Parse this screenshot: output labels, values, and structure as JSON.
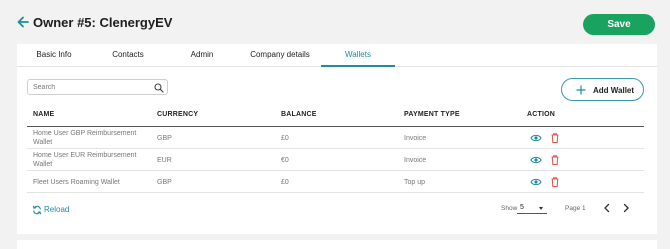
{
  "header": {
    "title": "Owner #5: ClenergyEV",
    "save_label": "Save"
  },
  "tabs": [
    {
      "label": "Basic Info",
      "active": false
    },
    {
      "label": "Contacts",
      "active": false
    },
    {
      "label": "Admin",
      "active": false
    },
    {
      "label": "Company details",
      "active": false
    },
    {
      "label": "Wallets",
      "active": true
    }
  ],
  "search": {
    "placeholder": "Search",
    "value": ""
  },
  "add_wallet_label": "Add Wallet",
  "table": {
    "columns": [
      "NAME",
      "CURRENCY",
      "BALANCE",
      "PAYMENT TYPE",
      "ACTION"
    ],
    "rows": [
      {
        "name": "Home User GBP Reimbursement Wallet",
        "currency": "GBP",
        "balance": "£0",
        "payment_type": "Invoice"
      },
      {
        "name": "Home User EUR Reimbursement Wallet",
        "currency": "EUR",
        "balance": "€0",
        "payment_type": "Invoice"
      },
      {
        "name": "Fleet Users Roaming Wallet",
        "currency": "GBP",
        "balance": "£0",
        "payment_type": "Top up"
      }
    ]
  },
  "footer": {
    "reload_label": "Reload",
    "show_label": "Show",
    "show_value": "5",
    "page_label": "Page 1"
  },
  "colors": {
    "accent": "#1f8da0",
    "save_green": "#1aa35f",
    "delete_red": "#e05a4f"
  },
  "icons": {
    "back": "arrow-left-icon",
    "search": "search-icon",
    "add": "plus-icon",
    "view": "eye-icon",
    "delete": "trash-icon",
    "reload": "refresh-icon",
    "prev": "chevron-left-icon",
    "next": "chevron-right-icon"
  }
}
